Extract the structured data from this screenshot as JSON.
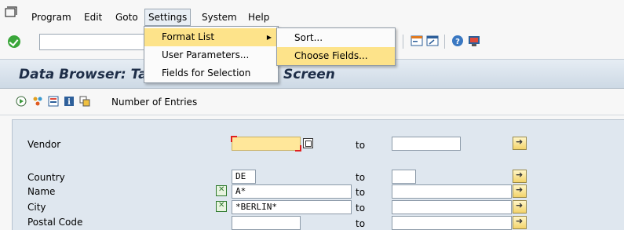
{
  "menubar": {
    "items": [
      {
        "label": "Program",
        "u": "P",
        "rest": "rogram"
      },
      {
        "label": "Edit",
        "u": "E",
        "rest": "dit"
      },
      {
        "label": "Goto",
        "u": "G",
        "rest": "oto"
      },
      {
        "label": "Settings",
        "u": "S",
        "rest": "ettings"
      },
      {
        "label": "System",
        "u": "",
        "rest": "System"
      },
      {
        "label": "Help",
        "u": "H",
        "rest": "elp"
      }
    ]
  },
  "title": {
    "part1": "Data Browser: Ta",
    "part2": "Screen"
  },
  "app_toolbar": {
    "num_entries": "Number of Entries"
  },
  "settings_menu": {
    "items": [
      "Format List",
      "User Parameters...",
      "Fields for Selection"
    ]
  },
  "format_list_submenu": {
    "items": [
      "Sort...",
      "Choose Fields..."
    ]
  },
  "selection": {
    "to_label": "to",
    "rows": [
      {
        "label": "Vendor",
        "from": "",
        "to": ""
      },
      {
        "label": "Country",
        "from": "DE",
        "to": ""
      },
      {
        "label": "Name",
        "from": "A*",
        "to": ""
      },
      {
        "label": "City",
        "from": "*BERLIN*",
        "to": ""
      },
      {
        "label": "Postal Code",
        "from": "",
        "to": ""
      }
    ]
  },
  "colors": {
    "highlight": "#fde38a",
    "title_text": "#1e2e48",
    "required_field": "#ffe79a"
  }
}
